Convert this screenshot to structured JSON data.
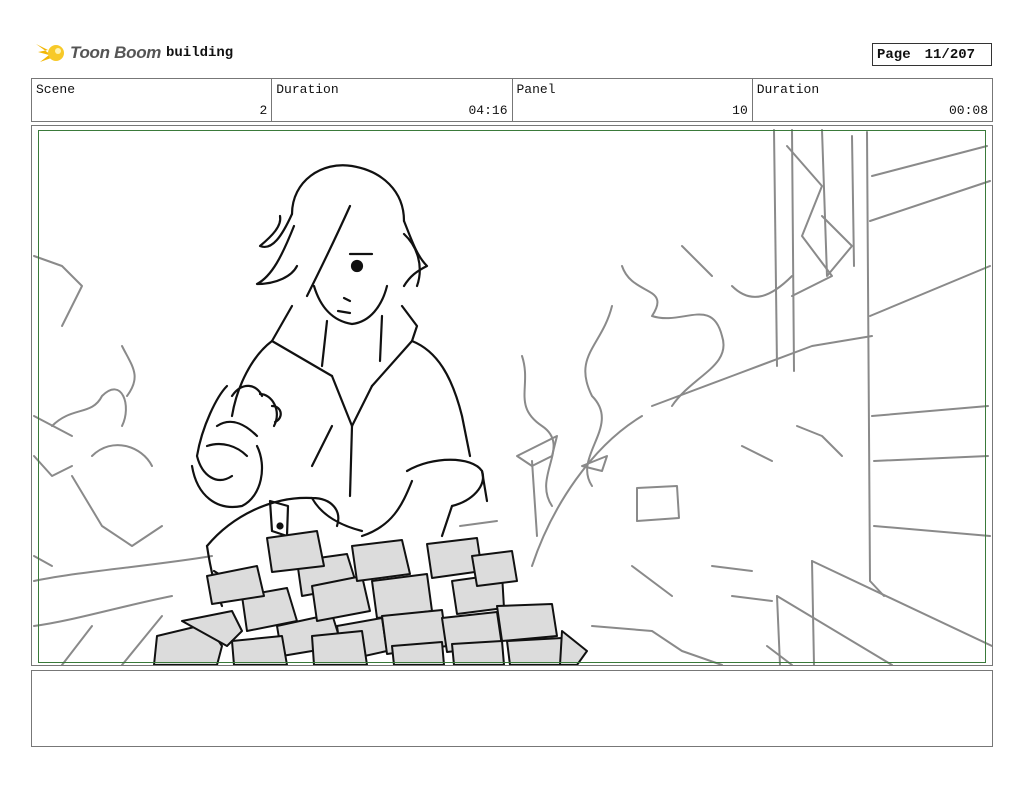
{
  "header": {
    "brand": "Toon Boom",
    "title": "building",
    "page_label": "Page",
    "page_value": "11/207"
  },
  "info": {
    "scene_label": "Scene",
    "scene_value": "2",
    "duration_label": "Duration",
    "duration_value": "04:16",
    "panel_label": "Panel",
    "panel_value": "10",
    "panel_duration_label": "Duration",
    "panel_duration_value": "00:08"
  },
  "icons": {
    "logo": "toon-boom-logo-icon"
  },
  "colors": {
    "safe_frame": "#3a7a3a",
    "logo_accent": "#f2b705",
    "sketch_dark": "#111111",
    "sketch_light": "#888888"
  },
  "notes": {
    "text": ""
  }
}
